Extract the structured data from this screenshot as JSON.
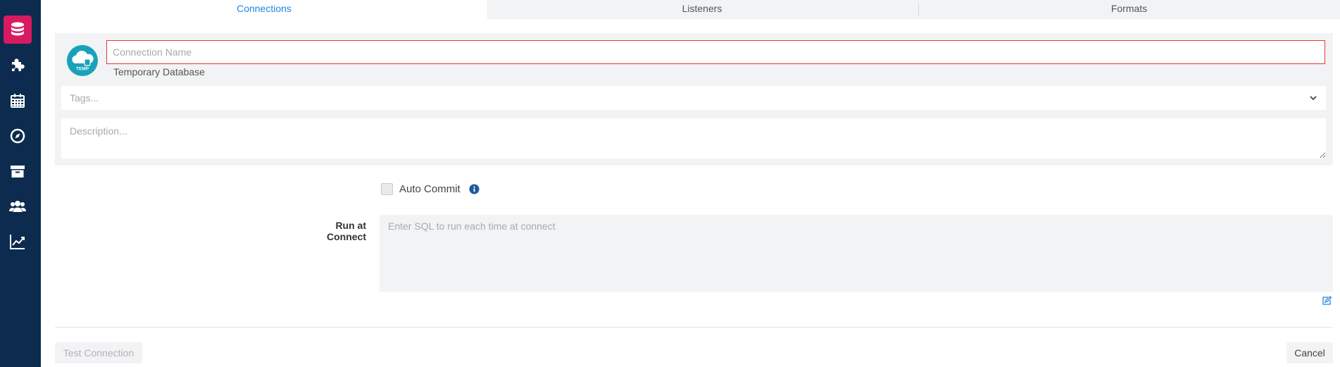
{
  "sidebar": {
    "items": [
      {
        "icon": "database-icon",
        "active": true
      },
      {
        "icon": "puzzle-icon",
        "active": false
      },
      {
        "icon": "calendar-icon",
        "active": false
      },
      {
        "icon": "compass-icon",
        "active": false
      },
      {
        "icon": "archive-icon",
        "active": false
      },
      {
        "icon": "users-icon",
        "active": false
      },
      {
        "icon": "chart-line-icon",
        "active": false
      }
    ]
  },
  "tabs": [
    {
      "label": "Connections",
      "active": true
    },
    {
      "label": "Listeners",
      "active": false
    },
    {
      "label": "Formats",
      "active": false
    }
  ],
  "connection": {
    "icon_badge": "TEMP",
    "name_value": "",
    "name_placeholder": "Connection Name",
    "db_type": "Temporary Database",
    "tags_placeholder": "Tags...",
    "description_placeholder": "Description..."
  },
  "options": {
    "auto_commit_label": "Auto Commit",
    "auto_commit_checked": false,
    "run_at_connect_label": "Run at Connect",
    "run_at_connect_placeholder": "Enter SQL to run each time at connect"
  },
  "footer": {
    "test_connection_label": "Test Connection",
    "cancel_label": "Cancel"
  },
  "colors": {
    "sidebar_bg": "#0d2b4e",
    "sidebar_active": "#d81b60",
    "tab_active_text": "#1e88e5",
    "invalid_border": "#e53935",
    "db_icon_bg": "#17a2b8"
  }
}
